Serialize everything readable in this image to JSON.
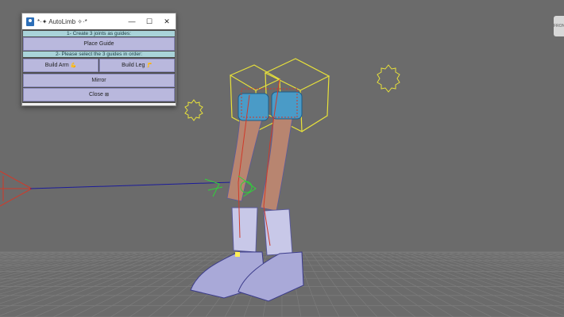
{
  "window": {
    "title": "*·✦ AutoLimb ✧·*",
    "minimize_glyph": "—",
    "maximize_glyph": "☐",
    "close_glyph": "✕",
    "header1": "1- Create 3 joints as guides:",
    "place_guide": "Place Guide",
    "header2": "2- Please select the 3 guides in order:",
    "build_arm": "Build Arm",
    "build_arm_emoji": "💪",
    "build_leg": "Build Leg",
    "build_leg_emoji": "🦵",
    "mirror": "Mirror",
    "close": "Close",
    "close_emoji": "⊠"
  },
  "viewport": {
    "view_cube_label": "FRONT"
  },
  "colors": {
    "viewport_bg": "#6b6b6b",
    "grid": "#7c7c7c",
    "header_strip": "#a9d3d9",
    "button": "#b9b8dd",
    "control_yellow": "#e8e23a",
    "locator_red": "#d03a2a",
    "ik_green": "#2fd33a",
    "mesh_blue": "#6d6fd6"
  }
}
